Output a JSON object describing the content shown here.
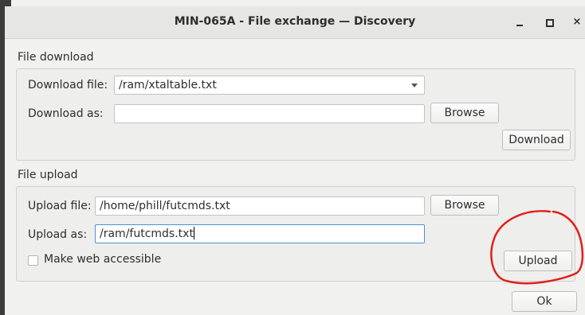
{
  "window": {
    "title": "MIN-065A - File exchange — Discovery",
    "close_glyph": "×",
    "controls": [
      "minimize-icon",
      "maximize-icon",
      "close-icon"
    ]
  },
  "download": {
    "section_label": "File download",
    "file_label": "Download file:",
    "file_value": "/ram/xtaltable.txt",
    "as_label": "Download as:",
    "as_value": "",
    "browse_label": "Browse",
    "download_label": "Download"
  },
  "upload": {
    "section_label": "File upload",
    "file_label": "Upload file:",
    "file_value": "/home/phill/futcmds.txt",
    "browse_label": "Browse",
    "as_label": "Upload as:",
    "as_value": "/ram/futcmds.txt",
    "web_accessible_label": "Make web accessible",
    "web_accessible_checked": false,
    "upload_label": "Upload"
  },
  "footer": {
    "ok_label": "Ok"
  },
  "colors": {
    "annotation": "#e0201b",
    "focus": "#4a90d9",
    "window_bg": "#f1f1f0"
  }
}
